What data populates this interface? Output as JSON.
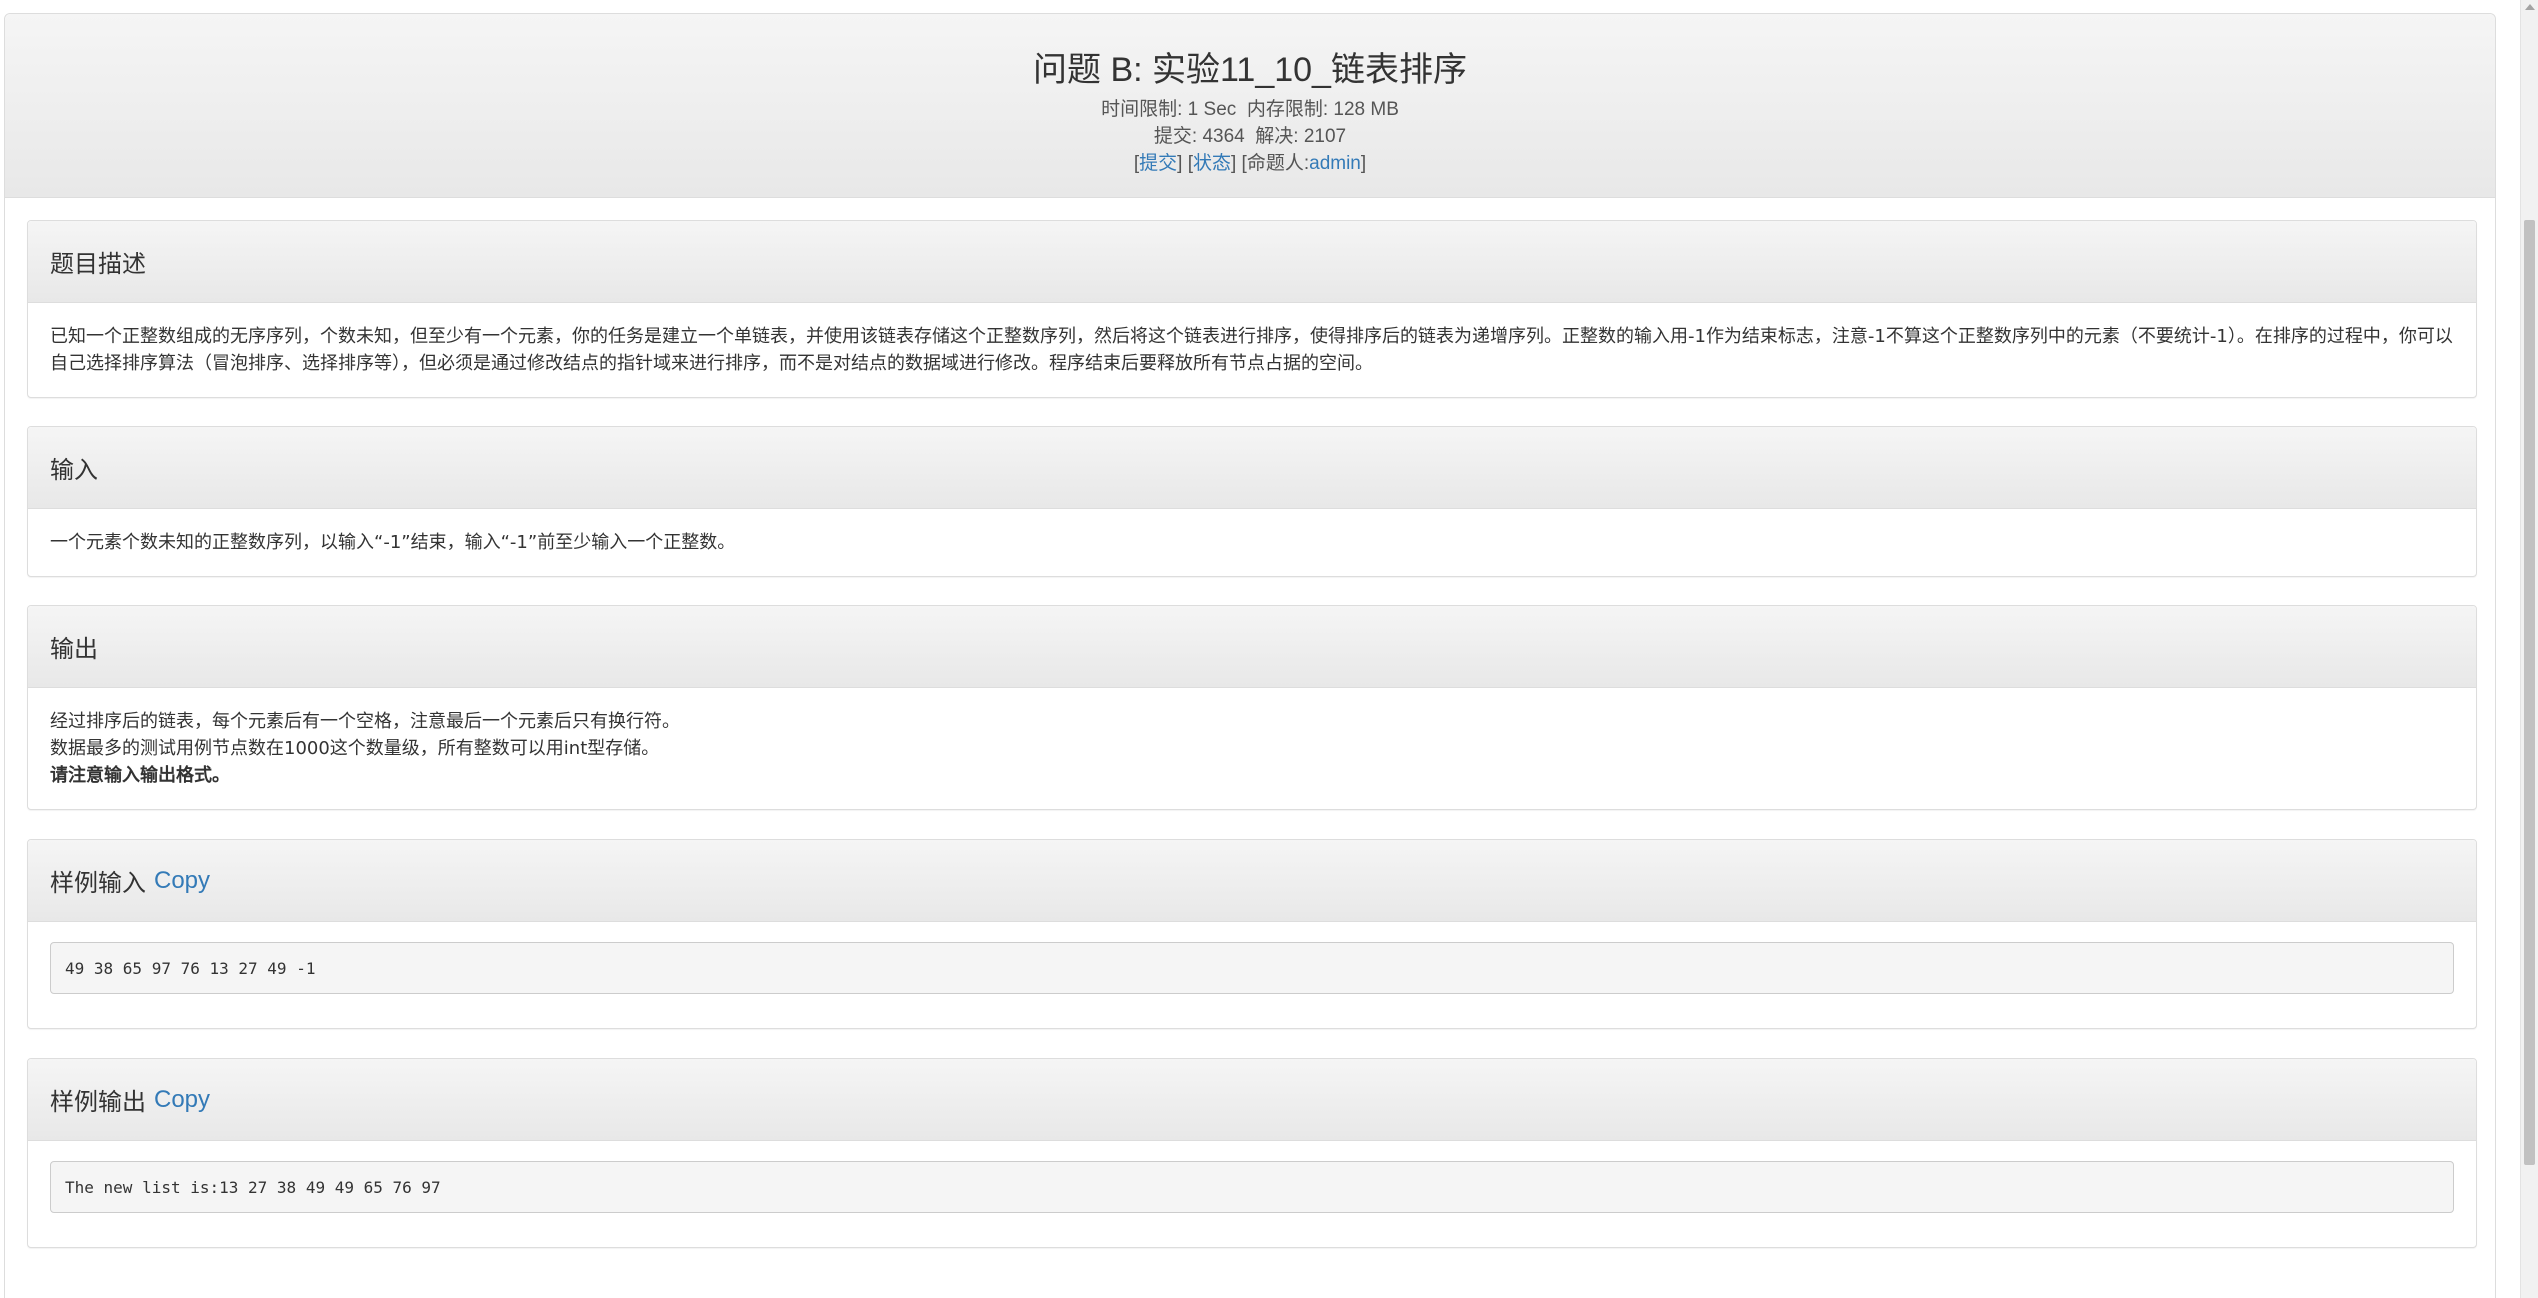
{
  "problem": {
    "title": "问题 B: 实验11_10_链表排序",
    "limits_line": "时间限制: 1 Sec  内存限制: 128 MB",
    "stats_line": "提交: 4364  解决: 2107",
    "links": {
      "submit": "提交",
      "status": "状态",
      "author_label": "命题人:",
      "author": "admin"
    }
  },
  "sections": {
    "description": {
      "heading": "题目描述",
      "text": "已知一个正整数组成的无序序列，个数未知，但至少有一个元素，你的任务是建立一个单链表，并使用该链表存储这个正整数序列，然后将这个链表进行排序，使得排序后的链表为递增序列。正整数的输入用-1作为结束标志，注意-1不算这个正整数序列中的元素（不要统计-1）。在排序的过程中，你可以自己选择排序算法（冒泡排序、选择排序等），但必须是通过修改结点的指针域来进行排序，而不是对结点的数据域进行修改。程序结束后要释放所有节点占据的空间。"
    },
    "input": {
      "heading": "输入",
      "text": "一个元素个数未知的正整数序列，以输入“-1”结束，输入“-1”前至少输入一个正整数。"
    },
    "output": {
      "heading": "输出",
      "lines": [
        "经过排序后的链表，每个元素后有一个空格，注意最后一个元素后只有换行符。",
        "数据最多的测试用例节点数在1000这个数量级，所有整数可以用int型存储。"
      ],
      "bold_line": "请注意输入输出格式。"
    },
    "sample_input": {
      "heading": "样例输入",
      "copy_label": "Copy",
      "content": "49 38 65 97 76 13 27 49 -1"
    },
    "sample_output": {
      "heading": "样例输出",
      "copy_label": "Copy",
      "content": "The new list is:13 27 38 49 49 65 76 97"
    }
  }
}
